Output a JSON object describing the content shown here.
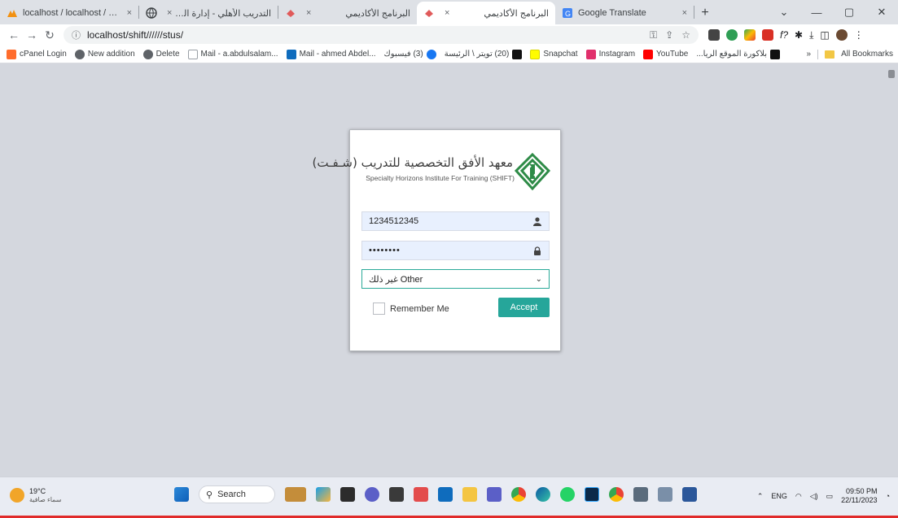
{
  "browser": {
    "tabs": [
      {
        "title": "localhost / localhost / shift / wel",
        "active": false,
        "rtl": false,
        "close": "×"
      },
      {
        "title": "التدريب الأهلي - إدارة الرخص",
        "active": false,
        "rtl": true,
        "close": "×"
      },
      {
        "title": "البرنامج الأكاديمي",
        "active": false,
        "rtl": true,
        "close": "×"
      },
      {
        "title": "البرنامج الأكاديمي",
        "active": true,
        "rtl": true,
        "close": "×"
      },
      {
        "title": "Google Translate",
        "active": false,
        "rtl": false,
        "close": "×"
      }
    ],
    "new_tab_label": "+",
    "window_controls": {
      "dropdown": "⌄",
      "minimize": "—",
      "maximize": "▢",
      "close": "✕"
    },
    "url": "localhost/shift//////stus/",
    "bookmarks": [
      {
        "label": "cPanel Login",
        "color": "#ff6c2c"
      },
      {
        "label": "New addition",
        "color": "#5f6368"
      },
      {
        "label": "Delete",
        "color": "#5f6368"
      },
      {
        "label": "Mail - a.abdulsalam...",
        "color": "#9aa0a6"
      },
      {
        "label": "Mail - ahmed Abdel...",
        "color": "#0f6cbd"
      },
      {
        "label": "(3) فيسبوك",
        "color": "#1877f2"
      },
      {
        "label": "(20) تويتر \\ الرئيسة",
        "color": "#111111"
      },
      {
        "label": "Snapchat",
        "color": "#fffc00"
      },
      {
        "label": "Instagram",
        "color": "#e1306c"
      },
      {
        "label": "YouTube",
        "color": "#ff0000"
      },
      {
        "label": "بلاكورة الموقع الريا...",
        "color": "#111111"
      }
    ],
    "bookmarks_overflow": "»",
    "all_bookmarks": "All Bookmarks"
  },
  "login": {
    "institute_ar": "معهد الأفق التخصصية للتدريب (شـفـت)",
    "institute_en": "Specialty Horizons Institute For Training (SHIFT)",
    "username_value": "1234512345",
    "password_value": "••••••••",
    "select_value": "غير ذلك Other",
    "remember_label": "Remember Me",
    "accept_label": "Accept",
    "accent_color": "#26a69a"
  },
  "taskbar": {
    "temperature": "19°C",
    "weather_desc": "سماء صافية",
    "search_label": "Search",
    "language": "ENG",
    "time": "09:50 PM",
    "date": "22/11/2023"
  }
}
